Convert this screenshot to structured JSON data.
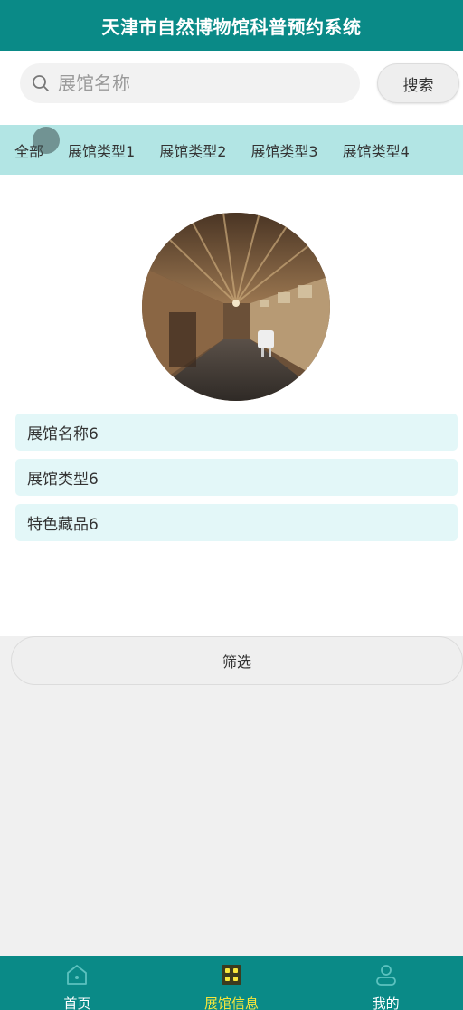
{
  "header": {
    "title": "天津市自然博物馆科普预约系统"
  },
  "search": {
    "placeholder": "展馆名称",
    "value": "",
    "button_label": "搜索"
  },
  "tabs": [
    {
      "label": "全部",
      "active": true
    },
    {
      "label": "展馆类型1"
    },
    {
      "label": "展馆类型2"
    },
    {
      "label": "展馆类型3"
    },
    {
      "label": "展馆类型4"
    }
  ],
  "item": {
    "fields": [
      {
        "value": "展馆名称6"
      },
      {
        "value": "展馆类型6"
      },
      {
        "value": "特色藏品6"
      }
    ]
  },
  "filter": {
    "button_label": "筛选"
  },
  "bottom_nav": [
    {
      "label": "首页",
      "icon": "home-icon"
    },
    {
      "label": "展馆信息",
      "icon": "grid-icon",
      "active": true
    },
    {
      "label": "我的",
      "icon": "user-icon"
    }
  ],
  "colors": {
    "primary": "#0a8a87",
    "tab_bar": "#b2e5e4",
    "info_row": "#e3f7f8",
    "active_nav": "#f5e63c"
  }
}
